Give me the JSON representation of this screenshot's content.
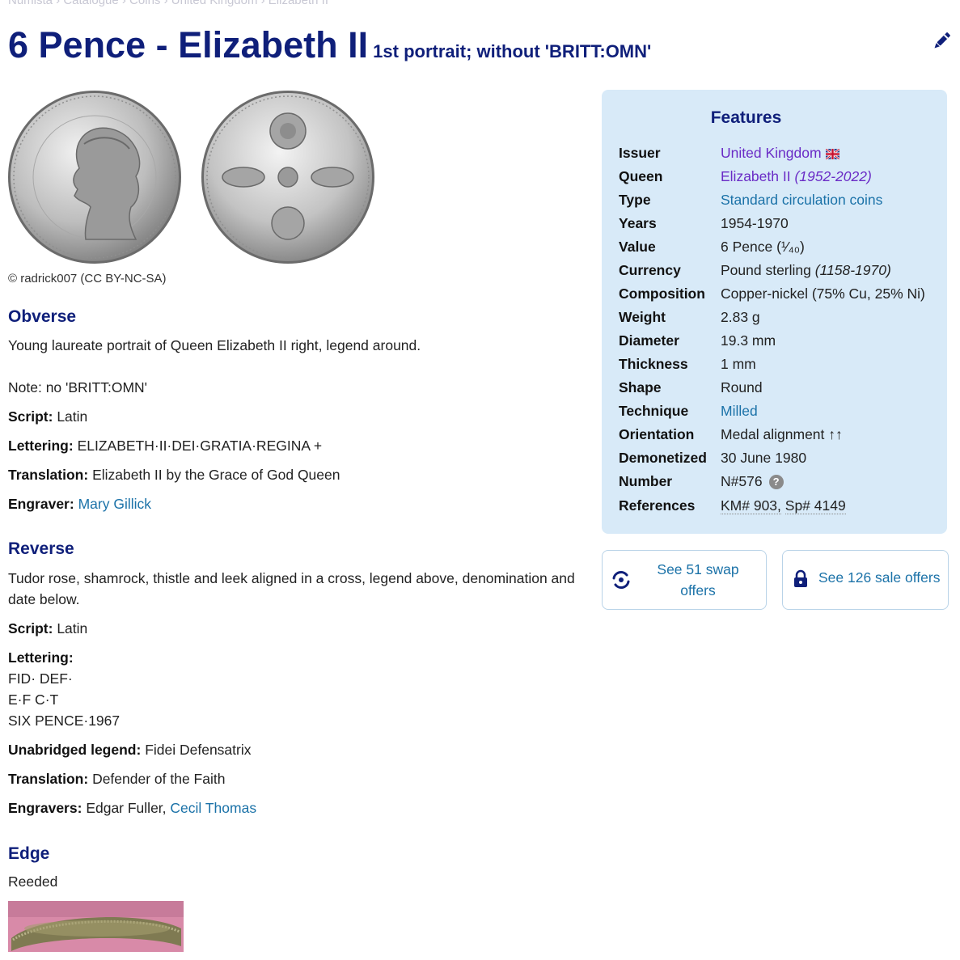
{
  "breadcrumb": "Numista › Catalogue › Coins › United Kingdom › Elizabeth II",
  "title": {
    "main": "6 Pence - Elizabeth II",
    "sub": "1st portrait; without 'BRITT:OMN'"
  },
  "credit": "© radrick007 (CC BY-NC-SA)",
  "obverse": {
    "heading": "Obverse",
    "description": "Young laureate portrait of Queen Elizabeth II right, legend around.",
    "note": "Note: no 'BRITT:OMN'",
    "script_label": "Script:",
    "script": "Latin",
    "lettering_label": "Lettering:",
    "lettering": "ELIZABETH·II·DEI·GRATIA·REGINA +",
    "translation_label": "Translation:",
    "translation": "Elizabeth II by the Grace of God Queen",
    "engraver_label": "Engraver:",
    "engraver": "Mary Gillick"
  },
  "reverse": {
    "heading": "Reverse",
    "description": "Tudor rose, shamrock, thistle and leek aligned in a cross, legend above, denomination and date below.",
    "script_label": "Script:",
    "script": "Latin",
    "lettering_label": "Lettering:",
    "lettering_lines": [
      "FID· DEF·",
      "E·F C·T",
      "SIX PENCE·1967"
    ],
    "unabridged_label": "Unabridged legend:",
    "unabridged": "Fidei Defensatrix",
    "translation_label": "Translation:",
    "translation": "Defender of the Faith",
    "engravers_label": "Engravers:",
    "engraver1": "Edgar Fuller,",
    "engraver2": "Cecil Thomas"
  },
  "edge": {
    "heading": "Edge",
    "description": "Reeded"
  },
  "features": {
    "title": "Features",
    "issuer_label": "Issuer",
    "issuer": "United Kingdom",
    "queen_label": "Queen",
    "queen": "Elizabeth II",
    "queen_years": "(1952-2022)",
    "type_label": "Type",
    "type": "Standard circulation coins",
    "years_label": "Years",
    "years": "1954-1970",
    "value_label": "Value",
    "value": "6 Pence (¹⁄₄₀)",
    "currency_label": "Currency",
    "currency": "Pound sterling",
    "currency_years": "(1158-1970)",
    "composition_label": "Composition",
    "composition": "Copper-nickel (75% Cu, 25% Ni)",
    "weight_label": "Weight",
    "weight": "2.83 g",
    "diameter_label": "Diameter",
    "diameter": "19.3 mm",
    "thickness_label": "Thickness",
    "thickness": "1 mm",
    "shape_label": "Shape",
    "shape": "Round",
    "technique_label": "Technique",
    "technique": "Milled",
    "orientation_label": "Orientation",
    "orientation": "Medal alignment ↑↑",
    "demonetized_label": "Demonetized",
    "demonetized": "30 June 1980",
    "number_label": "Number",
    "number": "N#576",
    "references_label": "References",
    "ref_km": "KM# 903,",
    "ref_sp": "Sp# 4149"
  },
  "offers": {
    "swap": "See 51 swap offers",
    "sale": "See 126 sale offers"
  },
  "colors": {
    "heading": "#0f1f7a",
    "link": "#1b72a8",
    "purple": "#6a2cc6",
    "panel": "#d8eaf8"
  },
  "icons": [
    "edit-pencil-icon",
    "uk-flag-icon",
    "help-icon",
    "swap-icon",
    "lock-icon"
  ]
}
